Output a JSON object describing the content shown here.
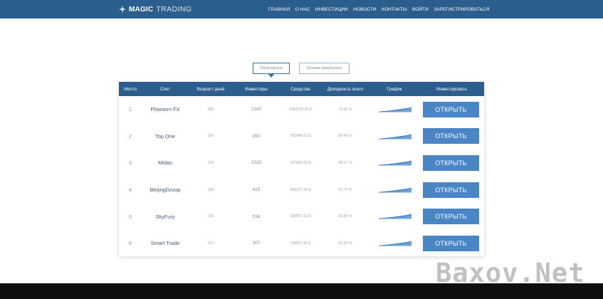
{
  "header": {
    "logo_bold": "MAGIC",
    "logo_thin": "TRADING",
    "nav": [
      "ГЛАВНАЯ",
      "О НАС",
      "ИНВЕСТИЦИИ",
      "НОВОСТИ",
      "КОНТАКТЫ",
      "ВОЙТИ",
      "ЗАРЕГИСТРИРОВАТЬСЯ"
    ]
  },
  "tabs": {
    "popular": "Популярные",
    "best": "Лучшие результаты"
  },
  "table": {
    "headers": [
      "Место",
      "Счет",
      "Возраст дней",
      "Инвесторы",
      "Средства",
      "Доходность всего",
      "График",
      "Инвестировать"
    ],
    "rows": [
      {
        "rank": "1",
        "name": "Phantom FX",
        "age": "183",
        "investors": "1240",
        "funds": "1084753.36 $",
        "yield": "75.46 %",
        "button": "ОТКРЫТЬ"
      },
      {
        "rank": "2",
        "name": "Top One",
        "age": "169",
        "investors": "392",
        "funds": "522848.12 $",
        "yield": "69.40 %",
        "button": "ОТКРЫТЬ"
      },
      {
        "rank": "3",
        "name": "Midas",
        "age": "134",
        "investors": "1033",
        "funds": "337863.52 $",
        "yield": "58.17 %",
        "button": "ОТКРЫТЬ"
      },
      {
        "rank": "4",
        "name": "BeijingGroup",
        "age": "156",
        "investors": "423",
        "funds": "843227.28 $",
        "yield": "62.75 %",
        "button": "ОТКРЫТЬ"
      },
      {
        "rank": "5",
        "name": "SkyFury",
        "age": "146",
        "investors": "316",
        "funds": "339957.13 $",
        "yield": "59.89 %",
        "button": "ОТКРЫТЬ"
      },
      {
        "rank": "6",
        "name": "Smart Trade",
        "age": "121",
        "investors": "307",
        "funds": "130667.53 $",
        "yield": "52.34 %",
        "button": "ОТКРЫТЬ"
      }
    ]
  },
  "watermark": "Baxov.Net"
}
